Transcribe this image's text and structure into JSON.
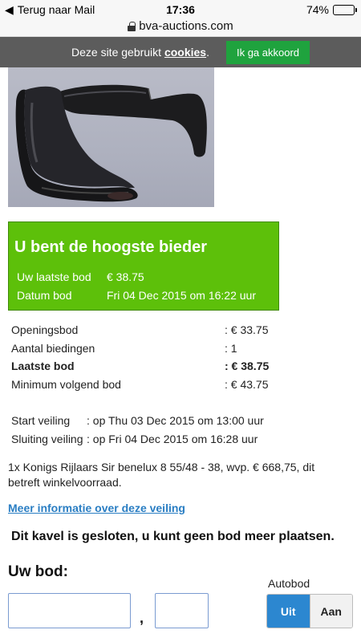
{
  "status_bar": {
    "back_label": "Terug naar Mail",
    "time": "17:36",
    "battery_percent": "74%",
    "battery_level": 0.74
  },
  "url_bar": {
    "domain": "bva-auctions.com"
  },
  "cookie_banner": {
    "message_prefix": "Deze site gebruikt ",
    "cookies_link": "cookies",
    "message_suffix": ".",
    "accept_label": "Ik ga akkoord"
  },
  "status_box": {
    "title": "U bent de hoogste bieder",
    "last_bid_label": "Uw laatste bod",
    "last_bid_value": "€ 38.75",
    "bid_date_label": "Datum bod",
    "bid_date_value": "Fri 04 Dec 2015 om 16:22 uur",
    "color": "#5dc00a"
  },
  "details": [
    {
      "label": "Openingsbod",
      "value": ": € 33.75",
      "bold": false
    },
    {
      "label": "Aantal biedingen",
      "value": ": 1",
      "bold": false
    },
    {
      "label": "Laatste bod",
      "value": ": € 38.75",
      "bold": true
    },
    {
      "label": "Minimum volgend bod",
      "value": ": € 43.75",
      "bold": false
    }
  ],
  "times": {
    "start_label": "Start veiling",
    "start_value": ": op Thu 03 Dec 2015 om 13:00 uur",
    "end_label": "Sluiting veiling",
    "end_value": ": op Fri 04 Dec 2015 om 16:28 uur"
  },
  "description": "1x Konigs Rijlaars Sir benelux 8 55/48 - 38, wvp. € 668,75, dit betreft winkelvoorraad.",
  "more_info_link": "Meer informatie over deze veiling",
  "closed_message": "Dit kavel is gesloten, u kunt geen bod meer plaatsen.",
  "bid_form": {
    "label": "Uw bod:",
    "amount_value": "",
    "cents_value": "",
    "comma": ",",
    "autobod_label": "Autobod",
    "autobod_off": "Uit",
    "autobod_on": "Aan",
    "accent_color": "#2c87d0"
  }
}
